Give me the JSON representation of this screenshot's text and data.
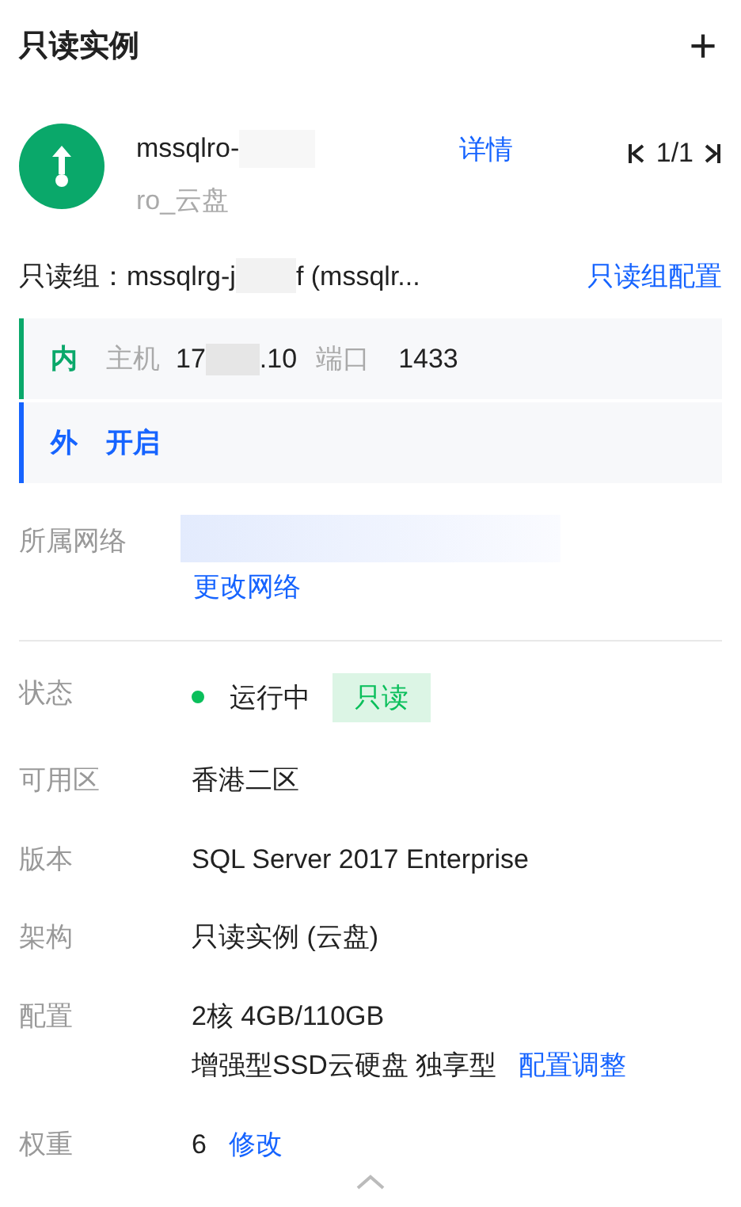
{
  "title": "只读实例",
  "add_button": "+",
  "instance": {
    "name": "mssqlro-",
    "subtitle": "ro_云盘",
    "detail_link": "详情",
    "pagination": "1/1"
  },
  "read_only_group": {
    "label": "只读组：",
    "name_start": "mssqlrg-j",
    "name_end": "f (mssqlr...",
    "config_link": "只读组配置"
  },
  "access": [
    {
      "kind": "internal",
      "tag": "内",
      "host_label": "主机",
      "host_start": "17",
      "host_end": ".10",
      "port_label": "端口",
      "port": "1433"
    },
    {
      "kind": "external",
      "tag": "外",
      "value": "开启"
    }
  ],
  "network": {
    "label": "所属网络",
    "change_link": "更改网络"
  },
  "fields": [
    {
      "kind": "status",
      "label": "状态",
      "value": "运行中",
      "badge": "只读",
      "color": "#0abf5b"
    },
    {
      "kind": "text",
      "label": "可用区",
      "value": "香港二区"
    },
    {
      "kind": "text",
      "label": "版本",
      "value": "SQL Server 2017 Enterprise"
    },
    {
      "kind": "text",
      "label": "架构",
      "value": "只读实例 (云盘)"
    },
    {
      "kind": "config",
      "label": "配置",
      "value": "2核 4GB/110GB",
      "value2": "增强型SSD云硬盘 独享型",
      "link": "配置调整"
    },
    {
      "kind": "weight",
      "label": "权重",
      "value": "6",
      "link": "修改"
    }
  ]
}
